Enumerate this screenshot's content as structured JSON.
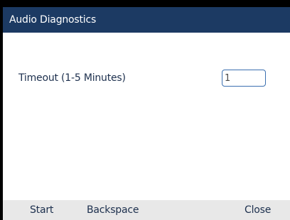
{
  "window": {
    "title": "Audio Diagnostics"
  },
  "form": {
    "timeout_label": "Timeout (1-5 Minutes)",
    "timeout_value": "1"
  },
  "softkeys": {
    "start": "Start",
    "backspace": "Backspace",
    "close": "Close"
  },
  "colors": {
    "title_bar": "#1c3a63",
    "softkey_bar": "#e8e8e8",
    "input_border": "#3b6fb0"
  }
}
